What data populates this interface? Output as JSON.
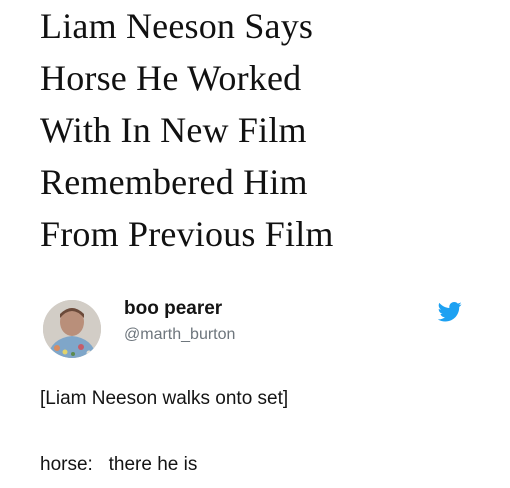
{
  "headline": {
    "lines": [
      "Liam Neeson Says",
      "Horse He Worked",
      "With In New Film",
      "Remembered Him",
      "From Previous Film"
    ]
  },
  "tweet": {
    "display_name": "boo pearer",
    "handle": "@marth_burton",
    "icon": "twitter-bird-icon",
    "avatar_icon": "profile-avatar",
    "lines": [
      "[Liam Neeson walks onto set]",
      "horse:   there he is"
    ]
  },
  "colors": {
    "text": "#111111",
    "handle": "#6e767d",
    "twitter_blue": "#1da1f2"
  }
}
